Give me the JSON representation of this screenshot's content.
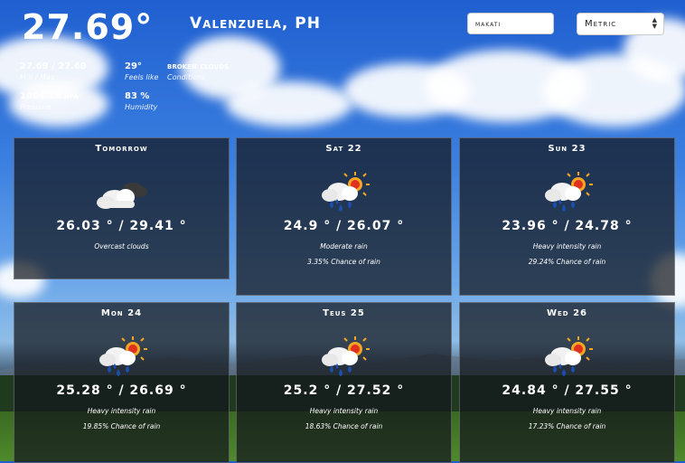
{
  "current": {
    "temperature": "27.69°",
    "city": "Valenzuela, PH",
    "min_max": "27.69 / 27.69",
    "min_max_label": "Min / Max",
    "feels_like": "29°",
    "feels_like_label": "Feels like",
    "conditions": "broken clouds",
    "conditions_label": "Conditions",
    "pressure": "1004.16 hpa",
    "pressure_label": "Pressure",
    "humidity": "83 %",
    "humidity_label": "Humidity"
  },
  "search": {
    "value": "makati"
  },
  "units": {
    "selected": "Metric"
  },
  "forecast": [
    {
      "day": "Tomorrow",
      "temps": "26.03 ° / 29.41 °",
      "description": "Overcast clouds",
      "chance": "",
      "icon": "overcast-clouds-icon"
    },
    {
      "day": "Sat 22",
      "temps": "24.9 ° / 26.07 °",
      "description": "Moderate rain",
      "chance": "3.35% Chance of rain",
      "icon": "sun-rain-icon"
    },
    {
      "day": "Sun 23",
      "temps": "23.96 ° / 24.78 °",
      "description": "Heavy intensity rain",
      "chance": "29.24% Chance of rain",
      "icon": "sun-rain-icon"
    },
    {
      "day": "Mon 24",
      "temps": "25.28 ° / 26.69 °",
      "description": "Heavy intensity rain",
      "chance": "19.85% Chance of rain",
      "icon": "sun-rain-icon"
    },
    {
      "day": "Teus 25",
      "temps": "25.2 ° / 27.52 °",
      "description": "Heavy intensity rain",
      "chance": "18.63% Chance of rain",
      "icon": "sun-rain-icon"
    },
    {
      "day": "Wed 26",
      "temps": "24.84 ° / 27.55 °",
      "description": "Heavy intensity rain",
      "chance": "17.23% Chance of rain",
      "icon": "sun-rain-icon"
    }
  ]
}
